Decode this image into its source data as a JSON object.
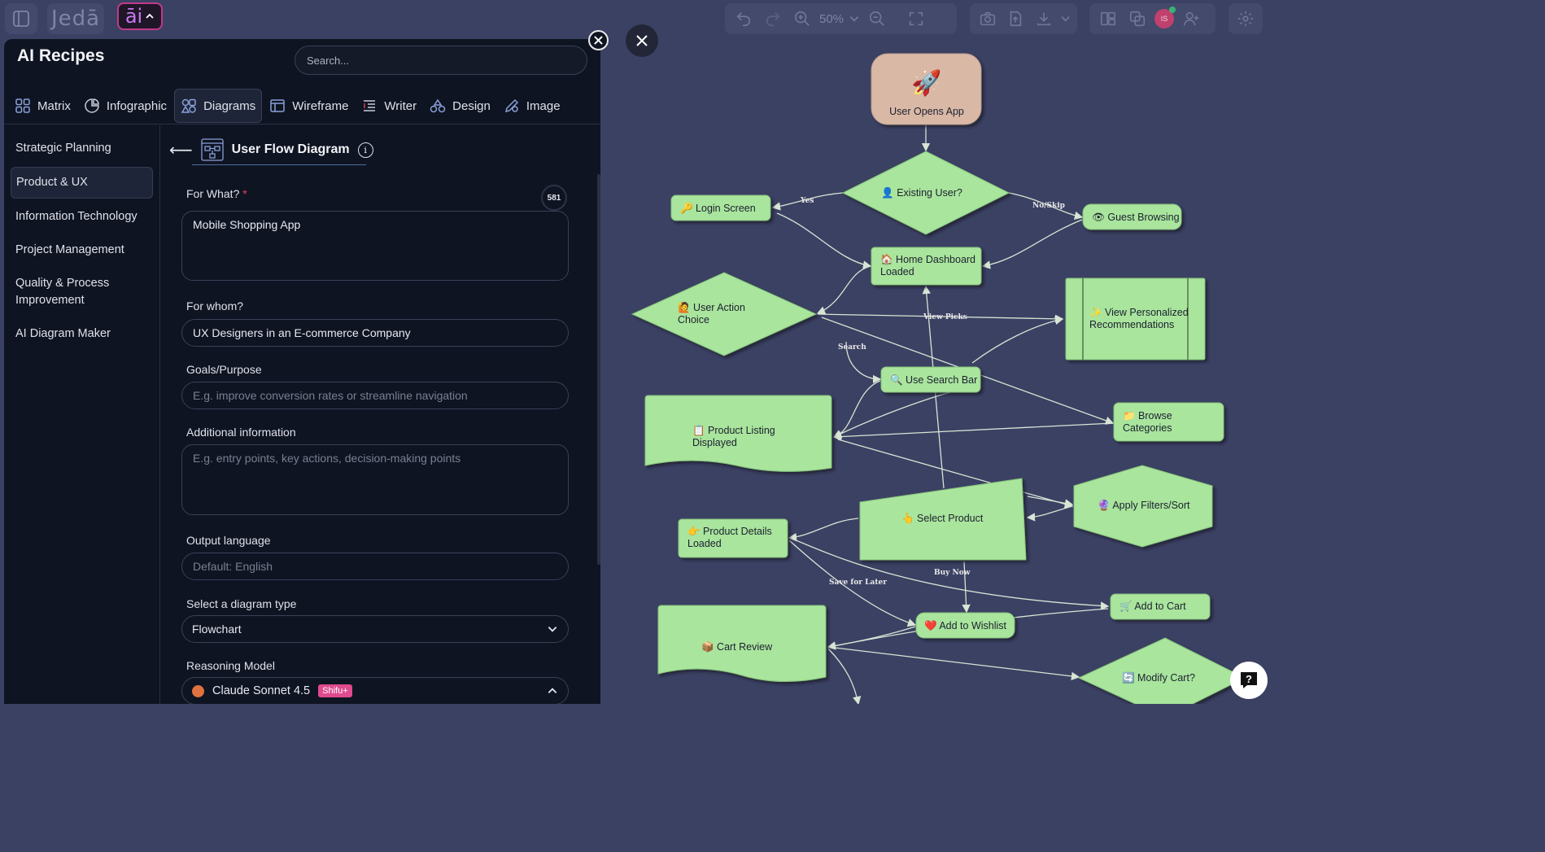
{
  "topbar": {
    "logo_text": "Jedā",
    "ai_badge": "āi",
    "zoom_level": "50%",
    "avatar_initials": "IS"
  },
  "panel": {
    "title": "AI Recipes",
    "search_placeholder": "Search...",
    "tabs": [
      {
        "label": "Matrix",
        "icon": "matrix-icon"
      },
      {
        "label": "Infographic",
        "icon": "infographic-icon"
      },
      {
        "label": "Diagrams",
        "icon": "diagrams-icon"
      },
      {
        "label": "Wireframe",
        "icon": "wireframe-icon"
      },
      {
        "label": "Writer",
        "icon": "writer-icon"
      },
      {
        "label": "Design",
        "icon": "design-icon"
      },
      {
        "label": "Image",
        "icon": "image-icon"
      }
    ],
    "sidebar": [
      {
        "label": "Strategic Planning"
      },
      {
        "label": "Product & UX"
      },
      {
        "label": "Information Technology"
      },
      {
        "label": "Project Management"
      },
      {
        "label": "Quality & Process Improvement"
      },
      {
        "label": "AI Diagram Maker"
      }
    ],
    "form": {
      "title": "User Flow Diagram",
      "for_what_label": "For What?",
      "required_mark": "*",
      "char_counter": "581",
      "for_what_value": "Mobile Shopping App",
      "for_whom_label": "For whom?",
      "for_whom_value": "UX Designers in an E-commerce Company",
      "goals_label": "Goals/Purpose",
      "goals_placeholder": "E.g. improve conversion rates or streamline navigation",
      "additional_label": "Additional information",
      "additional_placeholder": "E.g. entry points, key actions, decision-making points",
      "output_language_label": "Output language",
      "output_language_placeholder": "Default: English",
      "diagram_type_label": "Select a diagram type",
      "diagram_type_value": "Flowchart",
      "reasoning_label": "Reasoning Model",
      "reasoning_value": "Claude Sonnet 4.5",
      "reasoning_badge": "Shifu+"
    }
  },
  "diagram": {
    "node_color": "#a9e59d",
    "nodes": {
      "user_opens_app": {
        "emoji": "🚀",
        "label": "User Opens App"
      },
      "existing_user": "👤 Existing User?",
      "login_screen": "🔑 Login Screen",
      "guest_browsing": "👁 Guest Browsing",
      "home_dashboard_1": "🏠 Home Dashboard",
      "home_dashboard_2": "Loaded",
      "user_action_1": "🙋 User Action",
      "user_action_2": "Choice",
      "view_personalized_1": "✨ View Personalized",
      "view_personalized_2": "Recommendations",
      "use_search_bar": "🔍 Use Search Bar",
      "product_listing_1": "📋 Product Listing",
      "product_listing_2": "Displayed",
      "browse_categories_1": "📁 Browse",
      "browse_categories_2": "Categories",
      "select_product": "👆 Select Product",
      "apply_filters": "🔮 Apply Filters/Sort",
      "product_details_1": "👉 Product Details",
      "product_details_2": "Loaded",
      "add_to_cart": "🛒 Add to Cart",
      "add_to_wishlist": "❤️ Add to Wishlist",
      "cart_review": "📦 Cart Review",
      "modify_cart": "🔄 Modify Cart?"
    },
    "edge_labels": {
      "yes": "Yes",
      "no_skip": "No/Skip",
      "view_picks": "View Picks",
      "search": "Search",
      "buy_now": "Buy Now",
      "save_for_later": "Save for Later"
    }
  }
}
